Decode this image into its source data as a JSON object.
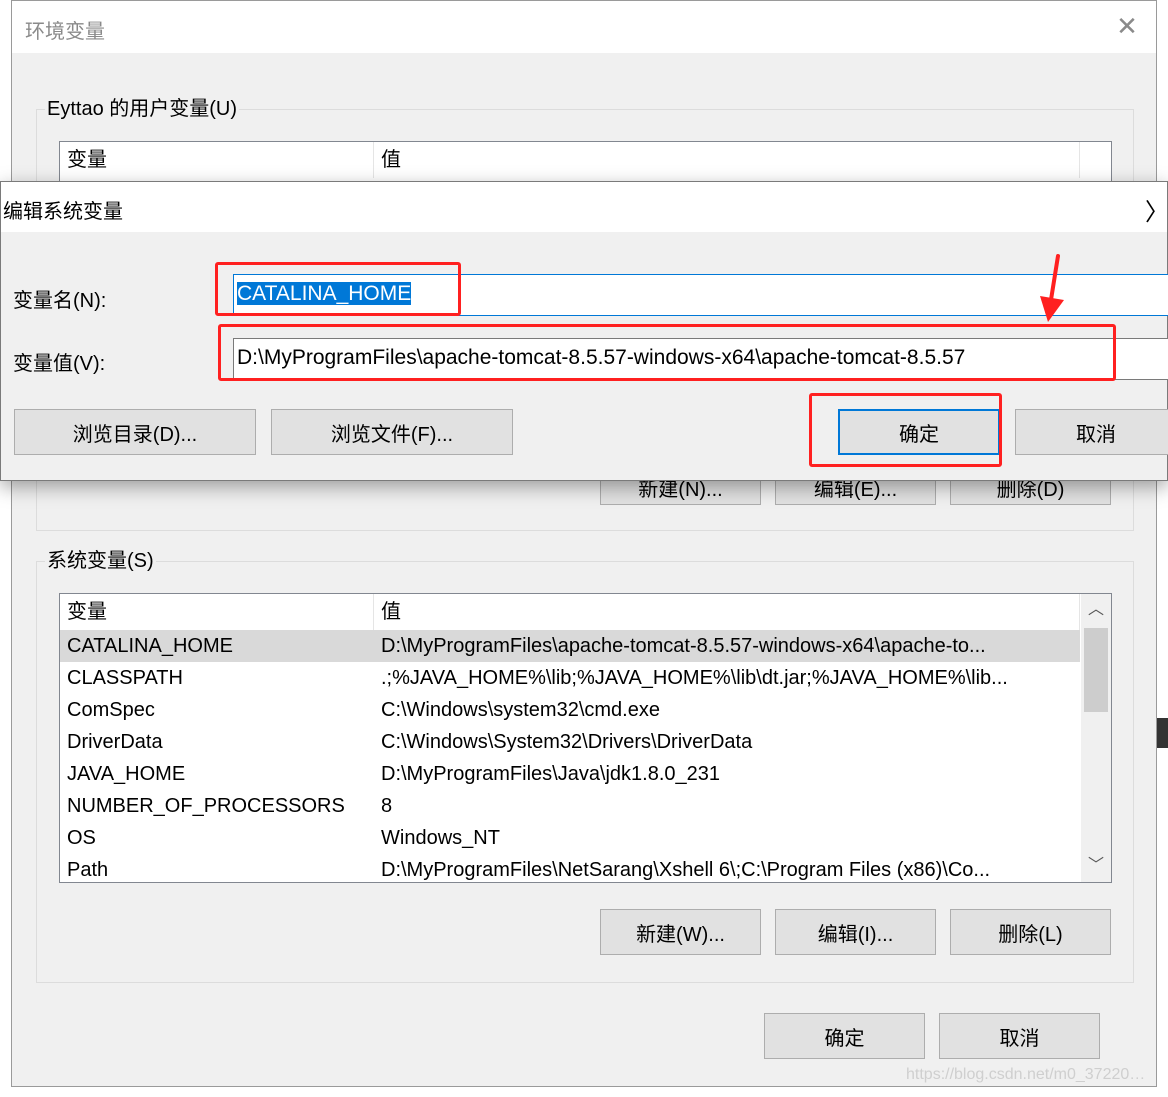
{
  "env_window": {
    "title": "环境变量",
    "user_vars": {
      "label": "Eyttao 的用户变量(U)",
      "col_var": "变量",
      "col_val": "值",
      "buttons": {
        "new": "新建(N)...",
        "edit": "编辑(E)...",
        "delete": "删除(D)"
      }
    },
    "system_vars": {
      "label": "系统变量(S)",
      "col_var": "变量",
      "col_val": "值",
      "rows": [
        {
          "name": "CATALINA_HOME",
          "value": "D:\\MyProgramFiles\\apache-tomcat-8.5.57-windows-x64\\apache-to..."
        },
        {
          "name": "CLASSPATH",
          "value": ".;%JAVA_HOME%\\lib;%JAVA_HOME%\\lib\\dt.jar;%JAVA_HOME%\\lib..."
        },
        {
          "name": "ComSpec",
          "value": "C:\\Windows\\system32\\cmd.exe"
        },
        {
          "name": "DriverData",
          "value": "C:\\Windows\\System32\\Drivers\\DriverData"
        },
        {
          "name": "JAVA_HOME",
          "value": "D:\\MyProgramFiles\\Java\\jdk1.8.0_231"
        },
        {
          "name": "NUMBER_OF_PROCESSORS",
          "value": "8"
        },
        {
          "name": "OS",
          "value": "Windows_NT"
        },
        {
          "name": "Path",
          "value": "D:\\MyProgramFiles\\NetSarang\\Xshell 6\\;C:\\Program Files (x86)\\Co..."
        }
      ],
      "buttons": {
        "new": "新建(W)...",
        "edit": "编辑(I)...",
        "delete": "删除(L)"
      }
    },
    "ok": "确定",
    "cancel": "取消"
  },
  "edit_dialog": {
    "title": "编辑系统变量",
    "name_label": "变量名(N):",
    "name_value": "CATALINA_HOME",
    "value_label": "变量值(V):",
    "value_value": "D:\\MyProgramFiles\\apache-tomcat-8.5.57-windows-x64\\apache-tomcat-8.5.57",
    "browse_dir": "浏览目录(D)...",
    "browse_file": "浏览文件(F)...",
    "ok": "确定",
    "cancel": "取消"
  },
  "watermark": "https://blog.csdn.net/m0_37220…",
  "colors": {
    "annotation": "#ff2020",
    "accent": "#0078d7"
  }
}
